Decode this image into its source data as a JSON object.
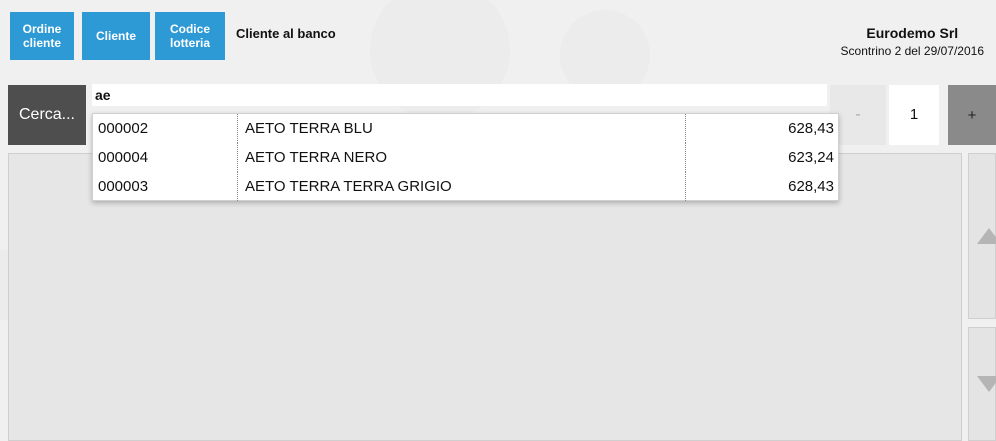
{
  "header": {
    "buttons": [
      {
        "label": "Ordine\ncliente"
      },
      {
        "label": "Cliente"
      },
      {
        "label": "Codice\nlotteria"
      }
    ],
    "client_label": "Cliente al banco",
    "company_name": "Eurodemo Srl",
    "receipt_info": "Scontrino 2 del 29/07/2016"
  },
  "search": {
    "button_label": "Cerca...",
    "query": "ae"
  },
  "quantity": {
    "minus_label": "-",
    "value": "1",
    "plus_label": "+"
  },
  "results": [
    {
      "code": "000002",
      "description": "AETO TERRA BLU",
      "price": "628,43"
    },
    {
      "code": "000004",
      "description": "AETO TERRA NERO",
      "price": "623,24"
    },
    {
      "code": "000003",
      "description": "AETO TERRA TERRA GRIGIO",
      "price": "628,43"
    }
  ],
  "icons": {
    "scroll_up": "triangle-up-icon",
    "scroll_down": "triangle-down-icon"
  }
}
